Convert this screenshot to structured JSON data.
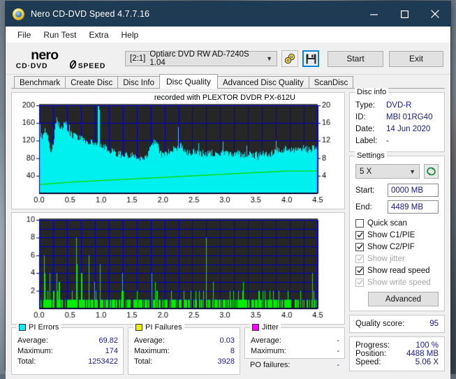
{
  "window": {
    "title": "Nero CD-DVD Speed 4.7.7.16",
    "app_icon": "nero-disc-icon",
    "controls": {
      "minimize": "minimize-icon",
      "maximize": "maximize-icon",
      "close": "close-icon"
    }
  },
  "menu": [
    "File",
    "Run Test",
    "Extra",
    "Help"
  ],
  "toolbar": {
    "logo_line1": "nero",
    "logo_line2": "CD·DVD SPEED",
    "drive_index": "[2:1]",
    "drive_name": "Optiarc DVD RW AD-7240S 1.04",
    "icon_buttons": [
      {
        "name": "disc-tools-icon",
        "selected": false
      },
      {
        "name": "save-icon",
        "selected": true
      }
    ],
    "start_label": "Start",
    "exit_label": "Exit"
  },
  "tabs": [
    {
      "label": "Benchmark",
      "active": false
    },
    {
      "label": "Create Disc",
      "active": false
    },
    {
      "label": "Disc Info",
      "active": false
    },
    {
      "label": "Disc Quality",
      "active": true
    },
    {
      "label": "Advanced Disc Quality",
      "active": false
    },
    {
      "label": "ScanDisc",
      "active": false
    }
  ],
  "chart_data": [
    {
      "type": "area",
      "title": "recorded with PLEXTOR  DVDR   PX-612U",
      "xlabel": "",
      "ylabel": "PI Errors",
      "xlim": [
        0.0,
        4.5
      ],
      "ylim": [
        0,
        200
      ],
      "y2lim": [
        0,
        20
      ],
      "xticks": [
        "0.0",
        "0.5",
        "1.0",
        "1.5",
        "2.0",
        "2.5",
        "3.0",
        "3.5",
        "4.0",
        "4.5"
      ],
      "yticks": [
        "40",
        "80",
        "120",
        "160",
        "200"
      ],
      "y2ticks": [
        "4",
        "8",
        "12",
        "16",
        "20"
      ],
      "grid": true,
      "bg": "#262626",
      "grid_color": "#0000cc",
      "series": [
        {
          "name": "PI Errors",
          "color": "#00f0f0",
          "kind": "area",
          "x": [
            0.0,
            0.05,
            0.09,
            0.14,
            0.18,
            0.23,
            0.27,
            0.32,
            0.36,
            0.41,
            0.45,
            0.5,
            0.54,
            0.59,
            0.63,
            0.68,
            0.72,
            0.77,
            0.81,
            0.86,
            0.9,
            0.95,
            0.99,
            1.04,
            1.08,
            1.13,
            1.17,
            1.22,
            1.26,
            1.31,
            1.35,
            1.4,
            1.44,
            1.49,
            1.53,
            1.58,
            1.62,
            1.67,
            1.71,
            1.76,
            1.8,
            1.85,
            1.89,
            1.94,
            1.98,
            2.03,
            2.07,
            2.12,
            2.16,
            2.21,
            2.25,
            2.3,
            2.34,
            2.39,
            2.43,
            2.48,
            2.52,
            2.57,
            2.61,
            2.66,
            2.7,
            2.75,
            2.79,
            2.84,
            2.88,
            2.93,
            2.97,
            3.02,
            3.06,
            3.11,
            3.15,
            3.2,
            3.24,
            3.29,
            3.33,
            3.38,
            3.42,
            3.47,
            3.51,
            3.56,
            3.6,
            3.65,
            3.69,
            3.74,
            3.78,
            3.83,
            3.87,
            3.92,
            3.96,
            4.01,
            4.05,
            4.1,
            4.14,
            4.19,
            4.23,
            4.28,
            4.32,
            4.37
          ],
          "values": [
            122,
            131,
            140,
            126,
            88,
            118,
            168,
            150,
            147,
            160,
            142,
            134,
            130,
            128,
            126,
            122,
            120,
            118,
            116,
            112,
            112,
            110,
            108,
            106,
            100,
            96,
            93,
            90,
            88,
            86,
            84,
            86,
            88,
            84,
            80,
            78,
            76,
            82,
            92,
            104,
            118,
            110,
            96,
            90,
            88,
            92,
            96,
            100,
            104,
            108,
            102,
            96,
            92,
            90,
            94,
            96,
            92,
            90,
            88,
            90,
            92,
            88,
            86,
            88,
            90,
            92,
            88,
            86,
            90,
            92,
            88,
            86,
            88,
            90,
            86,
            84,
            88,
            90,
            92,
            90,
            88,
            90,
            94,
            96,
            98,
            100,
            102,
            100,
            98,
            96,
            98,
            100,
            102,
            100,
            98,
            100,
            102,
            104
          ]
        },
        {
          "name": "read speed",
          "color": "#00dd00",
          "kind": "line",
          "axis": "right",
          "values": [
            2.0,
            2.05,
            2.1,
            2.15,
            2.2,
            2.25,
            2.3,
            2.35,
            2.4,
            2.45,
            2.5,
            2.55,
            2.6,
            2.62,
            2.65,
            2.7,
            2.72,
            2.75,
            2.8,
            2.82,
            2.85,
            2.9,
            2.92,
            2.95,
            3.0,
            3.02,
            3.05,
            3.1,
            3.12,
            3.15,
            3.2,
            3.22,
            3.25,
            3.3,
            3.32,
            3.35,
            3.4,
            3.42,
            3.45,
            3.5,
            3.52,
            3.55,
            3.6,
            3.62,
            3.65,
            3.7,
            3.72,
            3.75,
            3.8,
            3.82,
            3.85,
            3.9,
            3.92,
            3.95,
            4.0,
            4.02,
            4.05,
            4.1,
            4.12,
            4.15,
            4.2,
            4.22,
            4.25,
            4.3,
            4.32,
            4.35,
            4.4,
            4.42,
            4.45,
            4.5,
            4.52,
            4.55,
            4.6,
            4.62,
            4.65,
            4.7,
            4.72,
            4.75,
            4.8,
            4.82,
            4.85,
            4.9,
            4.92,
            4.95,
            5.0,
            5.02,
            5.05,
            5.06,
            5.06,
            5.06,
            5.06,
            5.06,
            5.06,
            5.06,
            5.06,
            5.06,
            5.06,
            5.06
          ]
        }
      ]
    },
    {
      "type": "bar",
      "title": "",
      "xlabel": "",
      "ylabel": "PI Failures",
      "xlim": [
        0.0,
        4.5
      ],
      "ylim": [
        0,
        10
      ],
      "xticks": [
        "0.0",
        "0.5",
        "1.0",
        "1.5",
        "2.0",
        "2.5",
        "3.0",
        "3.5",
        "4.0",
        "4.5"
      ],
      "yticks": [
        "2",
        "4",
        "6",
        "8",
        "10"
      ],
      "grid": true,
      "bg": "#262626",
      "grid_color": "#0000cc",
      "series": [
        {
          "name": "PI Failures",
          "color": "#00ee00",
          "values": [
            2,
            1,
            1,
            6,
            1,
            2,
            1,
            7,
            1,
            2,
            3,
            6,
            2,
            5,
            1,
            1,
            1,
            1,
            2,
            1,
            1,
            1,
            4,
            1,
            2,
            8,
            1,
            5,
            4,
            1,
            2,
            6,
            1,
            6,
            1,
            2,
            1,
            3,
            2,
            1,
            5,
            5,
            1,
            2,
            1,
            2,
            1,
            2,
            1,
            1,
            2,
            1,
            4,
            1,
            2,
            1,
            4,
            1,
            1,
            2,
            1,
            1,
            1,
            2,
            1,
            5,
            2,
            1,
            1,
            2,
            1,
            1,
            1,
            1,
            1,
            6,
            7,
            1,
            3,
            2,
            3,
            1,
            1,
            1,
            1,
            2,
            2,
            1,
            2,
            3,
            1,
            2,
            1,
            3,
            1,
            2,
            1,
            2,
            3,
            1,
            2,
            1,
            1,
            2,
            3,
            1,
            2,
            1,
            2,
            1,
            1,
            2,
            1,
            8,
            2,
            4,
            2,
            1,
            3,
            1,
            2,
            4,
            1,
            1,
            2,
            1,
            3,
            1,
            1,
            2,
            1,
            1,
            2,
            1,
            1,
            2,
            1,
            1,
            3,
            2,
            1,
            2,
            1,
            1,
            2,
            1,
            2,
            1,
            1,
            4,
            1,
            2,
            1,
            4,
            3,
            1,
            2,
            1,
            1,
            2,
            1,
            1,
            2,
            1,
            4,
            1,
            2,
            1,
            1,
            2,
            1,
            1,
            2,
            1,
            1,
            2,
            1,
            4,
            2,
            1,
            1,
            2,
            1,
            1,
            2,
            4,
            3,
            1,
            2,
            1
          ]
        }
      ]
    }
  ],
  "stats": {
    "pi_errors": {
      "legend": "PI Errors",
      "color": "#00f0f0",
      "rows": [
        {
          "label": "Average:",
          "value": "69.82"
        },
        {
          "label": "Maximum:",
          "value": "174"
        },
        {
          "label": "Total:",
          "value": "1253422"
        }
      ]
    },
    "pi_failures": {
      "legend": "PI Failures",
      "color": "#f0f000",
      "rows": [
        {
          "label": "Average:",
          "value": "0.03"
        },
        {
          "label": "Maximum:",
          "value": "8"
        },
        {
          "label": "Total:",
          "value": "3928"
        }
      ]
    },
    "jitter": {
      "legend": "Jitter",
      "color": "#ff00ff",
      "rows": [
        {
          "label": "Average:",
          "value": "-"
        },
        {
          "label": "Maximum:",
          "value": "-"
        }
      ],
      "po_failures_label": "PO failures:",
      "po_failures_value": "-"
    }
  },
  "disc_info": {
    "legend": "Disc info",
    "rows": [
      {
        "label": "Type:",
        "value": "DVD-R"
      },
      {
        "label": "ID:",
        "value": "MBI 01RG40"
      },
      {
        "label": "Date:",
        "value": "14 Jun 2020"
      },
      {
        "label": "Label:",
        "value": "-"
      }
    ]
  },
  "settings": {
    "legend": "Settings",
    "speed": "5 X",
    "refresh_icon": "refresh-icon",
    "start_label": "Start:",
    "start_value": "0000 MB",
    "end_label": "End:",
    "end_value": "4489 MB",
    "checkboxes": [
      {
        "label": "Quick scan",
        "checked": false,
        "disabled": false
      },
      {
        "label": "Show C1/PIE",
        "checked": true,
        "disabled": false
      },
      {
        "label": "Show C2/PIF",
        "checked": true,
        "disabled": false
      },
      {
        "label": "Show jitter",
        "checked": true,
        "disabled": true
      },
      {
        "label": "Show read speed",
        "checked": true,
        "disabled": false
      },
      {
        "label": "Show write speed",
        "checked": true,
        "disabled": true
      }
    ],
    "advanced_label": "Advanced"
  },
  "quality": {
    "label": "Quality score:",
    "value": "95"
  },
  "progress": {
    "rows": [
      {
        "label": "Progress:",
        "value": "100 %"
      },
      {
        "label": "Position:",
        "value": "4488 MB"
      },
      {
        "label": "Speed:",
        "value": "5.06 X"
      }
    ]
  }
}
